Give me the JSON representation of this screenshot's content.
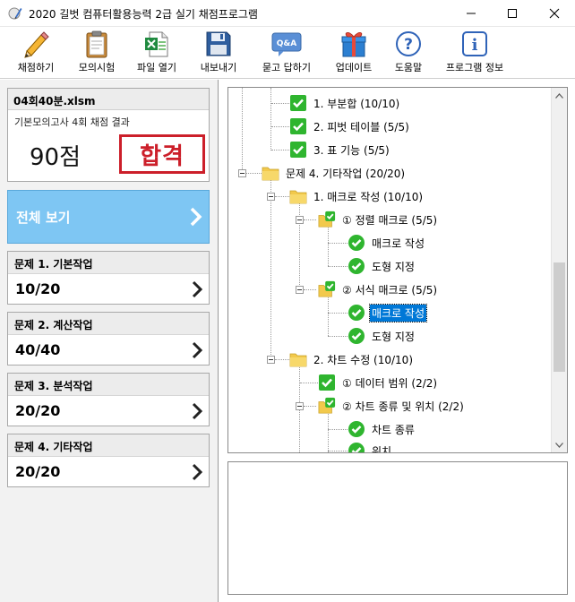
{
  "window": {
    "title": "2020 길벗 컴퓨터활용능력 2급 실기 채점프로그램"
  },
  "toolbar": {
    "items": [
      {
        "label": "채점하기",
        "icon": "pencil-icon"
      },
      {
        "label": "모의시험",
        "icon": "clipboard-icon"
      },
      {
        "label": "파일 열기",
        "icon": "excel-file-icon"
      },
      {
        "label": "내보내기",
        "icon": "floppy-disk-icon"
      },
      {
        "label": "묻고 답하기",
        "icon": "qa-bubble-icon"
      },
      {
        "label": "업데이트",
        "icon": "gift-box-icon"
      },
      {
        "label": "도움말",
        "icon": "help-icon"
      },
      {
        "label": "프로그램 정보",
        "icon": "info-icon"
      }
    ]
  },
  "result": {
    "file_name": "04회40분.xlsm",
    "subtitle": "기본모의고사 4회 채점 결과",
    "score": "90점",
    "stamp": "합격"
  },
  "view_all": {
    "label": "전체 보기"
  },
  "sections": [
    {
      "title": "문제 1. 기본작업",
      "score": "10/20"
    },
    {
      "title": "문제 2. 계산작업",
      "score": "40/40"
    },
    {
      "title": "문제 3. 분석작업",
      "score": "20/20"
    },
    {
      "title": "문제 4. 기타작업",
      "score": "20/20"
    }
  ],
  "tree": {
    "rows": [
      {
        "text": "1. 부분합 (10/10)",
        "icon": "check-square-icon"
      },
      {
        "text": "2. 피벗 테이블 (5/5)",
        "icon": "check-square-icon"
      },
      {
        "text": "3. 표 기능 (5/5)",
        "icon": "check-square-icon"
      },
      {
        "text": "문제 4. 기타작업 (20/20)",
        "icon": "folder-icon"
      },
      {
        "text": "1. 매크로 작성 (10/10)",
        "icon": "folder-icon"
      },
      {
        "text": "① 정렬 매크로 (5/5)",
        "icon": "folder-check-icon"
      },
      {
        "text": "매크로 작성",
        "icon": "check-circle-icon"
      },
      {
        "text": "도형 지정",
        "icon": "check-circle-icon"
      },
      {
        "text": "② 서식 매크로 (5/5)",
        "icon": "folder-check-icon"
      },
      {
        "text": "매크로 작성",
        "icon": "check-circle-icon"
      },
      {
        "text": "도형 지정",
        "icon": "check-circle-icon"
      },
      {
        "text": "2. 차트 수정 (10/10)",
        "icon": "folder-icon"
      },
      {
        "text": "① 데이터 범위 (2/2)",
        "icon": "check-square-icon"
      },
      {
        "text": "② 차트 종류 및 위치 (2/2)",
        "icon": "folder-check-icon"
      },
      {
        "text": "차트 종류",
        "icon": "check-circle-icon"
      },
      {
        "text": "위치",
        "icon": "check-circle-icon"
      }
    ]
  },
  "colors": {
    "view_all_bg": "#7ec6f3",
    "stamp_red": "#cc1f2a",
    "check_green": "#2fb52f",
    "folder_yellow": "#f2c94c",
    "selection_blue": "#0078d7"
  }
}
